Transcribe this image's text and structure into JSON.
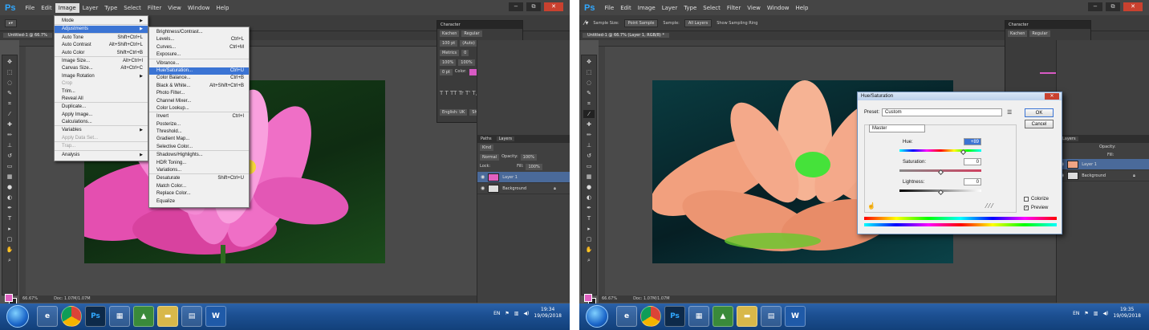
{
  "left": {
    "menubar": {
      "logo": "Ps",
      "items": [
        "File",
        "Edit",
        "Image",
        "Layer",
        "Type",
        "Select",
        "Filter",
        "View",
        "Window",
        "Help"
      ],
      "active_index": 2
    },
    "window_controls": [
      "−",
      "⧉",
      "✕"
    ],
    "doc_tab": "Untitled-1 @ 66.7%",
    "status": {
      "zoom": "66.67%",
      "doc": "Doc: 1.07M/1.07M"
    },
    "image_menu": [
      {
        "label": "Mode",
        "shortcut": "",
        "arrow": true,
        "sep": true
      },
      {
        "label": "Adjustments",
        "shortcut": "",
        "arrow": true,
        "hl": true,
        "sep": true
      },
      {
        "label": "Auto Tone",
        "shortcut": "Shift+Ctrl+L"
      },
      {
        "label": "Auto Contrast",
        "shortcut": "Alt+Shift+Ctrl+L"
      },
      {
        "label": "Auto Color",
        "shortcut": "Shift+Ctrl+B",
        "sep": true
      },
      {
        "label": "Image Size...",
        "shortcut": "Alt+Ctrl+I"
      },
      {
        "label": "Canvas Size...",
        "shortcut": "Alt+Ctrl+C"
      },
      {
        "label": "Image Rotation",
        "shortcut": "",
        "arrow": true
      },
      {
        "label": "Crop",
        "shortcut": "",
        "dis": true
      },
      {
        "label": "Trim..."
      },
      {
        "label": "Reveal All",
        "sep": true
      },
      {
        "label": "Duplicate..."
      },
      {
        "label": "Apply Image..."
      },
      {
        "label": "Calculations...",
        "sep": true
      },
      {
        "label": "Variables",
        "arrow": true
      },
      {
        "label": "Apply Data Set...",
        "dis": true,
        "sep": true
      },
      {
        "label": "Trap...",
        "dis": true,
        "sep": true
      },
      {
        "label": "Analysis",
        "arrow": true
      }
    ],
    "adjust_menu": [
      {
        "label": "Brightness/Contrast..."
      },
      {
        "label": "Levels...",
        "shortcut": "Ctrl+L"
      },
      {
        "label": "Curves...",
        "shortcut": "Ctrl+M"
      },
      {
        "label": "Exposure...",
        "sep": true
      },
      {
        "label": "Vibrance..."
      },
      {
        "label": "Hue/Saturation...",
        "shortcut": "Ctrl+U",
        "hl": true
      },
      {
        "label": "Color Balance...",
        "shortcut": "Ctrl+B"
      },
      {
        "label": "Black & White...",
        "shortcut": "Alt+Shift+Ctrl+B"
      },
      {
        "label": "Photo Filter..."
      },
      {
        "label": "Channel Mixer..."
      },
      {
        "label": "Color Lookup...",
        "sep": true
      },
      {
        "label": "Invert",
        "shortcut": "Ctrl+I"
      },
      {
        "label": "Posterize..."
      },
      {
        "label": "Threshold..."
      },
      {
        "label": "Gradient Map..."
      },
      {
        "label": "Selective Color...",
        "sep": true
      },
      {
        "label": "Shadows/Highlights..."
      },
      {
        "label": "HDR Toning..."
      },
      {
        "label": "Variations...",
        "sep": true
      },
      {
        "label": "Desaturate",
        "shortcut": "Shift+Ctrl+U"
      },
      {
        "label": "Match Color..."
      },
      {
        "label": "Replace Color..."
      },
      {
        "label": "Equalize"
      }
    ],
    "character": {
      "title": "Character",
      "font": "Kachen",
      "style": "Regular",
      "size": "100 pt",
      "leading": "(Auto)",
      "kerning": "Metrics",
      "tracking": "0",
      "vscale": "100%",
      "hscale": "100%",
      "baseline": "0 pt",
      "color_label": "Color:",
      "language": "English: UK",
      "aa": "Sharp"
    },
    "layers": {
      "tabs": [
        "Paths",
        "Layers"
      ],
      "kind": "Kind",
      "blend": "Normal",
      "opacity_label": "Opacity:",
      "opacity": "100%",
      "lock_label": "Lock:",
      "fill_label": "Fill:",
      "fill": "100%",
      "items": [
        "Layer 1",
        "Background"
      ]
    },
    "clock": {
      "time": "19:34",
      "date": "19/09/2018"
    }
  },
  "right": {
    "menubar": {
      "logo": "Ps",
      "items": [
        "File",
        "Edit",
        "Image",
        "Layer",
        "Type",
        "Select",
        "Filter",
        "View",
        "Window",
        "Help"
      ]
    },
    "options": {
      "sample_size_label": "Sample Size:",
      "sample_size": "Point Sample",
      "sample_label": "Sample:",
      "sample": "All Layers",
      "ring": "Show Sampling Ring"
    },
    "doc_tab": "Untitled-1 @ 66.7% (Layer 1, RGB/8) *",
    "status": {
      "zoom": "66.67%",
      "doc": "Doc: 1.07M/1.07M"
    },
    "character": {
      "title": "Character",
      "font": "Kachen",
      "style": "Regular"
    },
    "layers": {
      "tabs": [
        "Layers"
      ],
      "opacity_label": "Opacity:",
      "fill_label": "Fill:",
      "items": [
        "Layer 1",
        "Background"
      ]
    },
    "hue_sat": {
      "title": "Hue/Saturation",
      "preset_label": "Preset:",
      "preset": "Custom",
      "channel": "Master",
      "hue_label": "Hue:",
      "hue": "+89",
      "sat_label": "Saturation:",
      "sat": "0",
      "light_label": "Lightness:",
      "light": "0",
      "ok": "OK",
      "cancel": "Cancel",
      "colorize": "Colorize",
      "preview": "Preview"
    },
    "clock": {
      "time": "19:35",
      "date": "19/09/2018"
    }
  },
  "taskbar": {
    "lang": "EN",
    "apps": [
      "ie",
      "chrome",
      "ps",
      "network",
      "photos",
      "folder",
      "file",
      "word"
    ]
  },
  "colors": {
    "accent": "#3b74d4",
    "ps_blue": "#31a8ff",
    "pink": "#e060c0"
  }
}
